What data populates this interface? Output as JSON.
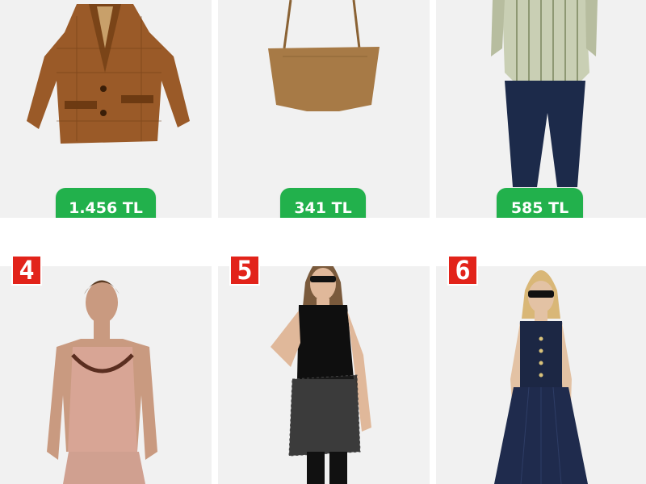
{
  "products": [
    {
      "image": "brown-plaid-blazer",
      "price": "1.456 TL"
    },
    {
      "image": "brown-bandeau-crop-top",
      "price": "341 TL"
    },
    {
      "image": "striped-shirt-and-jeans",
      "price": "585 TL"
    },
    {
      "image": "pink-satin-lace-camisole",
      "rank": "4"
    },
    {
      "image": "black-tank-and-lace-skirt",
      "rank": "5"
    },
    {
      "image": "denim-bustier-and-skirt",
      "rank": "6"
    }
  ],
  "colors": {
    "price_bg": "#22b14c",
    "badge_bg": "#e2231a",
    "tile_bg": "#f1f1f1"
  }
}
